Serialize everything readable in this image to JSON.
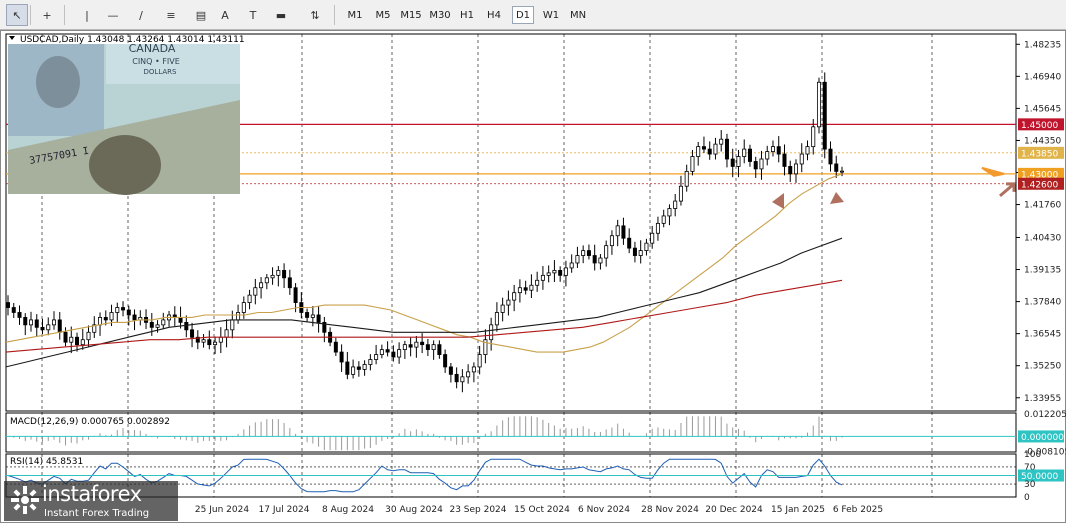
{
  "toolbar": {
    "tools": [
      {
        "name": "cursor-icon",
        "glyph": "↖",
        "active": true
      },
      {
        "name": "crosshair-icon",
        "glyph": "+",
        "active": false
      },
      {
        "name": "vertical-line-icon",
        "glyph": "|",
        "active": false
      },
      {
        "name": "horizontal-line-icon",
        "glyph": "—",
        "active": false
      },
      {
        "name": "trendline-icon",
        "glyph": "∕",
        "active": false
      },
      {
        "name": "fibonacci-icon",
        "glyph": "≡",
        "active": false
      },
      {
        "name": "channel-icon",
        "glyph": "▤",
        "active": false
      },
      {
        "name": "text-icon",
        "glyph": "A",
        "active": false
      },
      {
        "name": "text-label-icon",
        "glyph": "T",
        "active": false
      },
      {
        "name": "rectangle-icon",
        "glyph": "▬",
        "active": false
      },
      {
        "name": "arrows-icon",
        "glyph": "⇅",
        "active": false
      }
    ],
    "timeframes": [
      "M1",
      "M5",
      "M15",
      "M30",
      "H1",
      "H4",
      "D1",
      "W1",
      "MN"
    ],
    "active_timeframe": "D1"
  },
  "chart_header": {
    "symbol": "USDCAD,Daily",
    "ohlc": "1.43048 1.43264 1.43014 1.43111"
  },
  "chart_data": {
    "type": "candlestick",
    "symbol": "USDCAD",
    "timeframe": "Daily",
    "open": 1.43048,
    "high": 1.43264,
    "low": 1.43014,
    "close": 1.43111,
    "ylim": [
      1.3342,
      1.4865
    ],
    "price_ticks": [
      "1.48235",
      "1.46940",
      "1.45645",
      "1.44350",
      "1.43055",
      "1.41760",
      "1.40430",
      "1.39135",
      "1.37840",
      "1.36545",
      "1.35250",
      "1.33955"
    ],
    "date_ticks": [
      "25 Jun 2024",
      "17 Jul 2024",
      "8 Aug 2024",
      "30 Aug 2024",
      "23 Sep 2024",
      "15 Oct 2024",
      "6 Nov 2024",
      "28 Nov 2024",
      "20 Dec 2024",
      "15 Jan 2025",
      "6 Feb 2025"
    ],
    "levels": [
      {
        "value": 1.45,
        "label": "1.45000",
        "color": "#c0142c",
        "style": "solid"
      },
      {
        "value": 1.4385,
        "label": "1.43850",
        "color": "#e0b44a",
        "style": "dotted"
      },
      {
        "value": 1.43,
        "label": "1.43000",
        "color": "#f0a020",
        "style": "solid"
      },
      {
        "value": 1.426,
        "label": "1.42600",
        "color": "#b02020",
        "style": "dotted"
      }
    ],
    "closes": [
      1.376,
      1.374,
      1.372,
      1.369,
      1.371,
      1.368,
      1.367,
      1.369,
      1.371,
      1.366,
      1.362,
      1.364,
      1.361,
      1.363,
      1.366,
      1.369,
      1.372,
      1.371,
      1.374,
      1.376,
      1.375,
      1.373,
      1.371,
      1.372,
      1.37,
      1.368,
      1.369,
      1.371,
      1.373,
      1.372,
      1.37,
      1.367,
      1.364,
      1.362,
      1.363,
      1.361,
      1.362,
      1.364,
      1.367,
      1.371,
      1.374,
      1.378,
      1.381,
      1.384,
      1.386,
      1.388,
      1.389,
      1.391,
      1.388,
      1.384,
      1.378,
      1.374,
      1.372,
      1.373,
      1.37,
      1.366,
      1.362,
      1.358,
      1.354,
      1.349,
      1.352,
      1.351,
      1.353,
      1.355,
      1.357,
      1.359,
      1.358,
      1.356,
      1.359,
      1.361,
      1.36,
      1.362,
      1.361,
      1.359,
      1.361,
      1.357,
      1.352,
      1.349,
      1.346,
      1.348,
      1.35,
      1.352,
      1.357,
      1.363,
      1.369,
      1.374,
      1.377,
      1.379,
      1.382,
      1.384,
      1.383,
      1.385,
      1.387,
      1.389,
      1.39,
      1.391,
      1.389,
      1.392,
      1.394,
      1.397,
      1.399,
      1.397,
      1.394,
      1.396,
      1.401,
      1.405,
      1.409,
      1.404,
      1.4,
      1.397,
      1.399,
      1.402,
      1.406,
      1.41,
      1.413,
      1.416,
      1.419,
      1.425,
      1.431,
      1.437,
      1.441,
      1.44,
      1.438,
      1.442,
      1.444,
      1.436,
      1.433,
      1.437,
      1.44,
      1.435,
      1.432,
      1.436,
      1.439,
      1.441,
      1.438,
      1.433,
      1.43,
      1.434,
      1.438,
      1.441,
      1.449,
      1.467,
      1.44,
      1.434,
      1.431,
      1.4311
    ],
    "series": [
      {
        "name": "MA-short",
        "color": "#c9a04a",
        "values": [
          1.362,
          1.363,
          1.364,
          1.365,
          1.366,
          1.367,
          1.368,
          1.369,
          1.37,
          1.37,
          1.371,
          1.371,
          1.372,
          1.372,
          1.372,
          1.373,
          1.373,
          1.373,
          1.373,
          1.374,
          1.374,
          1.375,
          1.376,
          1.376,
          1.377,
          1.377,
          1.377,
          1.377,
          1.376,
          1.375,
          1.373,
          1.371,
          1.369,
          1.367,
          1.365,
          1.364,
          1.362,
          1.361,
          1.36,
          1.359,
          1.358,
          1.358,
          1.358,
          1.359,
          1.36,
          1.362,
          1.365,
          1.368,
          1.372,
          1.376,
          1.38,
          1.384,
          1.388,
          1.392,
          1.396,
          1.401,
          1.405,
          1.409,
          1.413,
          1.418,
          1.422,
          1.425,
          1.428,
          1.43
        ]
      },
      {
        "name": "MA-mid",
        "color": "#1a1a1a",
        "values": [
          1.352,
          1.354,
          1.356,
          1.358,
          1.36,
          1.362,
          1.364,
          1.366,
          1.368,
          1.369,
          1.37,
          1.371,
          1.371,
          1.371,
          1.371,
          1.37,
          1.369,
          1.368,
          1.367,
          1.366,
          1.366,
          1.366,
          1.366,
          1.366,
          1.367,
          1.368,
          1.369,
          1.37,
          1.371,
          1.372,
          1.374,
          1.376,
          1.378,
          1.38,
          1.382,
          1.385,
          1.388,
          1.391,
          1.394,
          1.398,
          1.401,
          1.404
        ]
      },
      {
        "name": "MA-long",
        "color": "#b01818",
        "values": [
          1.358,
          1.359,
          1.36,
          1.361,
          1.362,
          1.363,
          1.363,
          1.364,
          1.364,
          1.364,
          1.364,
          1.364,
          1.364,
          1.364,
          1.364,
          1.364,
          1.364,
          1.365,
          1.366,
          1.367,
          1.368,
          1.37,
          1.372,
          1.374,
          1.376,
          1.378,
          1.381,
          1.383,
          1.385,
          1.387
        ]
      }
    ],
    "macd": {
      "label": "MACD(12,26,9) 0.000765 0.002892",
      "ticks": [
        "0.012205",
        "0.000000",
        "-0.008105"
      ],
      "ylim": [
        -0.0085,
        0.0128
      ]
    },
    "rsi": {
      "label": "RSI(14) 45.8531",
      "ticks": [
        "100",
        "70",
        "50.0000",
        "30",
        "0"
      ],
      "ylim": [
        0,
        100
      ],
      "value": 45.8531
    }
  },
  "logo": {
    "name": "instaforex",
    "tagline": "Instant Forex Trading"
  },
  "banknote_caption": {
    "line1": "CANADA",
    "line2": "CINQ • FIVE",
    "line3": "DOLLARS",
    "serial": "37757091 I"
  },
  "colors": {
    "bg": "#ffffff",
    "grid": "#000000",
    "bull": "#000000",
    "bear": "#000000",
    "tag_cyan": "#2ec4c4",
    "arrow_orange": "#f29a2e",
    "arrow_brown": "#b07060"
  }
}
